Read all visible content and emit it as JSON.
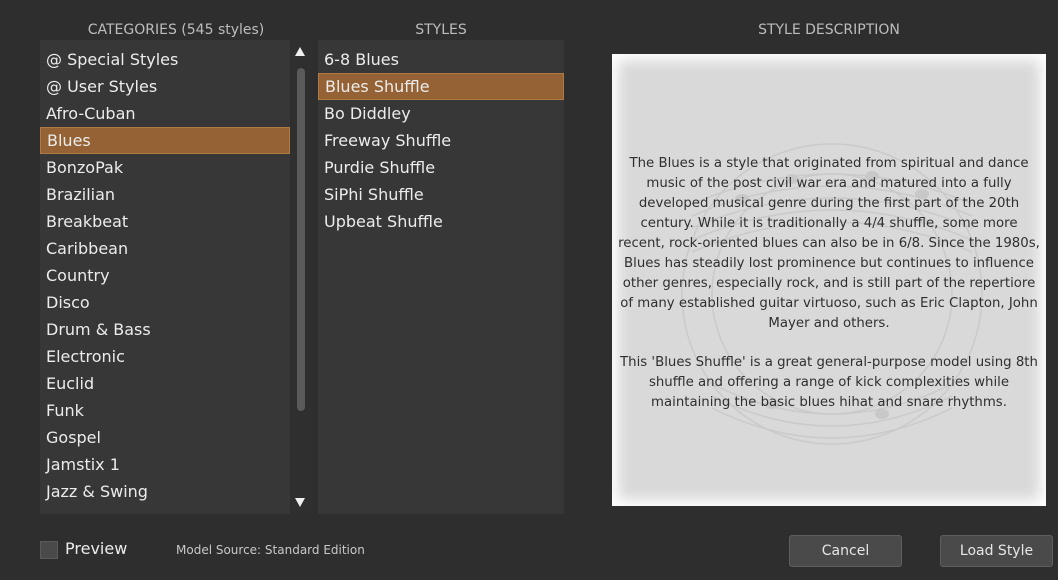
{
  "headers": {
    "categories": "CATEGORIES (545 styles)",
    "styles": "STYLES",
    "description": "STYLE DESCRIPTION"
  },
  "categories": {
    "items": [
      "@ Special Styles",
      "@ User Styles",
      "Afro-Cuban",
      "Blues",
      "BonzoPak",
      "Brazilian",
      "Breakbeat",
      "Caribbean",
      "Country",
      "Disco",
      "Drum & Bass",
      "Electronic",
      "Euclid",
      "Funk",
      "Gospel",
      "Jamstix 1",
      "Jazz & Swing"
    ],
    "selected": "Blues",
    "scroll_position": 0.0,
    "visible_fraction": 0.82
  },
  "styles": {
    "items": [
      "6-8 Blues",
      "Blues Shuffle",
      "Bo Diddley",
      "Freeway Shuffle",
      "Purdie Shuffle",
      "SiPhi Shuffle",
      "Upbeat Shuffle"
    ],
    "selected": "Blues Shuffle"
  },
  "description": {
    "paragraph1": "The Blues is a style that originated from spiritual and dance music of the post civil war era and matured into a fully developed musical genre during the first part of the 20th century. While it is traditionally a 4/4 shuffle, some more recent, rock-oriented blues can also be in 6/8. Since the 1980s, Blues has steadily lost prominence but continues to influence other genres, especially rock, and is still part of the repertiore of many established guitar virtuoso, such as Eric Clapton, John Mayer and others.",
    "paragraph2": "This 'Blues Shuffle' is a great general-purpose model using 8th shuffle and offering a range of kick complexities while maintaining the basic blues hihat and snare rhythms."
  },
  "footer": {
    "preview_label": "Preview",
    "preview_checked": false,
    "model_source": "Model Source: Standard Edition",
    "cancel_label": "Cancel",
    "load_label": "Load Style"
  },
  "colors": {
    "selection": "#946234",
    "background": "#2e2e2e",
    "panel": "#373737"
  }
}
